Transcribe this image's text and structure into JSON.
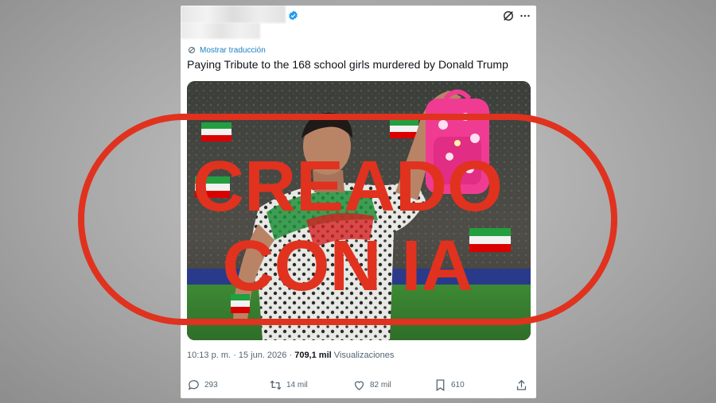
{
  "tweet": {
    "translate_label": "Mostrar traducción",
    "text": "Paying Tribute to the 168 school girls murdered by Donald Trump",
    "time": "10:13 p. m.",
    "sep1": "·",
    "date": "15 jun. 2026",
    "sep2": "·",
    "views_count": "709,1 mil",
    "views_label": "Visualizaciones"
  },
  "actions": {
    "replies": "293",
    "retweets": "14 mil",
    "likes": "82 mil",
    "bookmarks": "610"
  },
  "overlay": {
    "line1": "CREADO",
    "line2": "CON IA"
  },
  "colors": {
    "stamp_red": "#e0321e",
    "link_blue": "#1d7fc4",
    "verified_blue": "#1d9bf0",
    "backpack_pink": "#ef3c92"
  },
  "icons": [
    "verified-badge-icon",
    "grok-icon",
    "more-icon",
    "translate-icon",
    "reply-icon",
    "retweet-icon",
    "like-icon",
    "bookmark-icon",
    "share-icon"
  ]
}
